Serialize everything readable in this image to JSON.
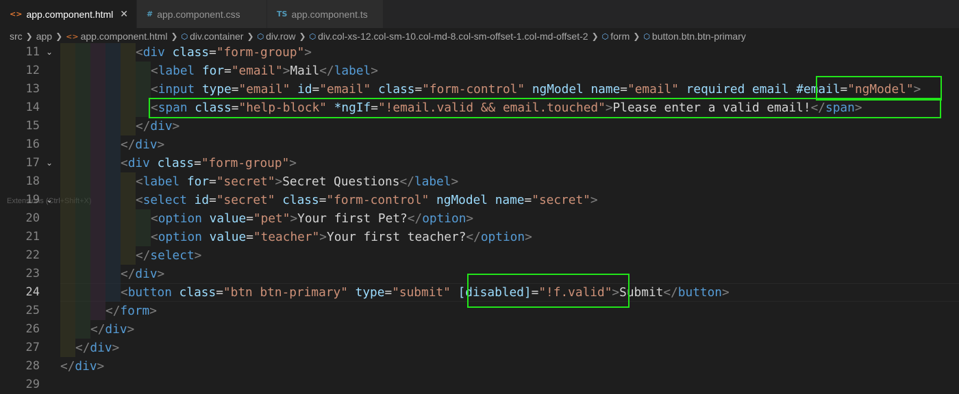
{
  "tabs": [
    {
      "icon": "<>",
      "icon_name": "html-file-icon",
      "label": "app.component.html",
      "active": true,
      "color": "#e37933"
    },
    {
      "icon": "#",
      "icon_name": "css-file-icon",
      "label": "app.component.css",
      "active": false,
      "color": "#519aba"
    },
    {
      "icon": "TS",
      "icon_name": "ts-file-icon",
      "label": "app.component.ts",
      "active": false,
      "color": "#519aba"
    }
  ],
  "breadcrumb": [
    {
      "label": "src",
      "icon": ""
    },
    {
      "label": "app",
      "icon": ""
    },
    {
      "label": "app.component.html",
      "icon": "<>"
    },
    {
      "label": "div.container",
      "icon": "⬡"
    },
    {
      "label": "div.row",
      "icon": "⬡"
    },
    {
      "label": "div.col-xs-12.col-sm-10.col-md-8.col-sm-offset-1.col-md-offset-2",
      "icon": "⬡"
    },
    {
      "label": "form",
      "icon": "⬡"
    },
    {
      "label": "button.btn.btn-primary",
      "icon": "⬡"
    }
  ],
  "ghost_tooltip": "Extensions (Ctrl+Shift+X)",
  "current_line": 24,
  "lines": [
    {
      "n": "11",
      "fold": true,
      "indent": 5,
      "tokens": [
        [
          "br",
          "<"
        ],
        [
          "tag",
          "div"
        ],
        [
          "txt",
          " "
        ],
        [
          "attr",
          "class"
        ],
        [
          "txt",
          "="
        ],
        [
          "str",
          "\"form-group\""
        ],
        [
          "br",
          ">"
        ]
      ]
    },
    {
      "n": "12",
      "fold": false,
      "indent": 6,
      "tokens": [
        [
          "br",
          "<"
        ],
        [
          "tag",
          "label"
        ],
        [
          "txt",
          " "
        ],
        [
          "attr",
          "for"
        ],
        [
          "txt",
          "="
        ],
        [
          "str",
          "\"email\""
        ],
        [
          "br",
          ">"
        ],
        [
          "txt",
          "Mail"
        ],
        [
          "br",
          "</"
        ],
        [
          "tag",
          "label"
        ],
        [
          "br",
          ">"
        ]
      ]
    },
    {
      "n": "13",
      "fold": false,
      "indent": 6,
      "tokens": [
        [
          "br",
          "<"
        ],
        [
          "tag",
          "input"
        ],
        [
          "txt",
          " "
        ],
        [
          "attr",
          "type"
        ],
        [
          "txt",
          "="
        ],
        [
          "str",
          "\"email\""
        ],
        [
          "txt",
          " "
        ],
        [
          "attr",
          "id"
        ],
        [
          "txt",
          "="
        ],
        [
          "str",
          "\"email\""
        ],
        [
          "txt",
          " "
        ],
        [
          "attr",
          "class"
        ],
        [
          "txt",
          "="
        ],
        [
          "str",
          "\"form-control\""
        ],
        [
          "txt",
          " "
        ],
        [
          "attr",
          "ngModel"
        ],
        [
          "txt",
          " "
        ],
        [
          "attr",
          "name"
        ],
        [
          "txt",
          "="
        ],
        [
          "str",
          "\"email\""
        ],
        [
          "txt",
          " "
        ],
        [
          "attr",
          "required"
        ],
        [
          "txt",
          " "
        ],
        [
          "attr",
          "email"
        ],
        [
          "txt",
          " "
        ],
        [
          "attr",
          "#email"
        ],
        [
          "txt",
          "="
        ],
        [
          "str",
          "\"ngModel\""
        ],
        [
          "br",
          ">"
        ]
      ]
    },
    {
      "n": "14",
      "fold": false,
      "indent": 6,
      "tokens": [
        [
          "br",
          "<"
        ],
        [
          "tag",
          "span"
        ],
        [
          "txt",
          " "
        ],
        [
          "attr",
          "class"
        ],
        [
          "txt",
          "="
        ],
        [
          "str",
          "\"help-block\""
        ],
        [
          "txt",
          " "
        ],
        [
          "attr",
          "*ngIf"
        ],
        [
          "txt",
          "="
        ],
        [
          "str",
          "\"!email.valid && email.touched\""
        ],
        [
          "br",
          ">"
        ],
        [
          "txt",
          "Please enter a valid email!"
        ],
        [
          "br",
          "</"
        ],
        [
          "tag",
          "span"
        ],
        [
          "br",
          ">"
        ]
      ]
    },
    {
      "n": "15",
      "fold": false,
      "indent": 5,
      "tokens": [
        [
          "br",
          "</"
        ],
        [
          "tag",
          "div"
        ],
        [
          "br",
          ">"
        ]
      ]
    },
    {
      "n": "16",
      "fold": false,
      "indent": 4,
      "tokens": [
        [
          "br",
          "</"
        ],
        [
          "tag",
          "div"
        ],
        [
          "br",
          ">"
        ]
      ]
    },
    {
      "n": "17",
      "fold": true,
      "indent": 4,
      "tokens": [
        [
          "br",
          "<"
        ],
        [
          "tag",
          "div"
        ],
        [
          "txt",
          " "
        ],
        [
          "attr",
          "class"
        ],
        [
          "txt",
          "="
        ],
        [
          "str",
          "\"form-group\""
        ],
        [
          "br",
          ">"
        ]
      ]
    },
    {
      "n": "18",
      "fold": false,
      "indent": 5,
      "tokens": [
        [
          "br",
          "<"
        ],
        [
          "tag",
          "label"
        ],
        [
          "txt",
          " "
        ],
        [
          "attr",
          "for"
        ],
        [
          "txt",
          "="
        ],
        [
          "str",
          "\"secret\""
        ],
        [
          "br",
          ">"
        ],
        [
          "txt",
          "Secret Questions"
        ],
        [
          "br",
          "</"
        ],
        [
          "tag",
          "label"
        ],
        [
          "br",
          ">"
        ]
      ]
    },
    {
      "n": "19",
      "fold": true,
      "indent": 5,
      "tokens": [
        [
          "br",
          "<"
        ],
        [
          "tag",
          "select"
        ],
        [
          "txt",
          " "
        ],
        [
          "attr",
          "id"
        ],
        [
          "txt",
          "="
        ],
        [
          "str",
          "\"secret\""
        ],
        [
          "txt",
          " "
        ],
        [
          "attr",
          "class"
        ],
        [
          "txt",
          "="
        ],
        [
          "str",
          "\"form-control\""
        ],
        [
          "txt",
          " "
        ],
        [
          "attr",
          "ngModel"
        ],
        [
          "txt",
          " "
        ],
        [
          "attr",
          "name"
        ],
        [
          "txt",
          "="
        ],
        [
          "str",
          "\"secret\""
        ],
        [
          "br",
          ">"
        ]
      ]
    },
    {
      "n": "20",
      "fold": false,
      "indent": 6,
      "tokens": [
        [
          "br",
          "<"
        ],
        [
          "tag",
          "option"
        ],
        [
          "txt",
          " "
        ],
        [
          "attr",
          "value"
        ],
        [
          "txt",
          "="
        ],
        [
          "str",
          "\"pet\""
        ],
        [
          "br",
          ">"
        ],
        [
          "txt",
          "Your first Pet?"
        ],
        [
          "br",
          "</"
        ],
        [
          "tag",
          "option"
        ],
        [
          "br",
          ">"
        ]
      ]
    },
    {
      "n": "21",
      "fold": false,
      "indent": 6,
      "tokens": [
        [
          "br",
          "<"
        ],
        [
          "tag",
          "option"
        ],
        [
          "txt",
          " "
        ],
        [
          "attr",
          "value"
        ],
        [
          "txt",
          "="
        ],
        [
          "str",
          "\"teacher\""
        ],
        [
          "br",
          ">"
        ],
        [
          "txt",
          "Your first teacher?"
        ],
        [
          "br",
          "</"
        ],
        [
          "tag",
          "option"
        ],
        [
          "br",
          ">"
        ]
      ]
    },
    {
      "n": "22",
      "fold": false,
      "indent": 5,
      "tokens": [
        [
          "br",
          "</"
        ],
        [
          "tag",
          "select"
        ],
        [
          "br",
          ">"
        ]
      ]
    },
    {
      "n": "23",
      "fold": false,
      "indent": 4,
      "tokens": [
        [
          "br",
          "</"
        ],
        [
          "tag",
          "div"
        ],
        [
          "br",
          ">"
        ]
      ]
    },
    {
      "n": "24",
      "fold": false,
      "indent": 4,
      "tokens": [
        [
          "br",
          "<"
        ],
        [
          "tag",
          "button"
        ],
        [
          "txt",
          " "
        ],
        [
          "attr",
          "class"
        ],
        [
          "txt",
          "="
        ],
        [
          "str",
          "\"btn btn-primary\""
        ],
        [
          "txt",
          " "
        ],
        [
          "attr",
          "type"
        ],
        [
          "txt",
          "="
        ],
        [
          "str",
          "\"submit\""
        ],
        [
          "txt",
          " "
        ],
        [
          "attr",
          "[disabled]"
        ],
        [
          "txt",
          "="
        ],
        [
          "str",
          "\"!f.valid\""
        ],
        [
          "br",
          ">"
        ],
        [
          "txt",
          "Submit"
        ],
        [
          "br",
          "</"
        ],
        [
          "tag",
          "button"
        ],
        [
          "br",
          ">"
        ]
      ]
    },
    {
      "n": "25",
      "fold": false,
      "indent": 3,
      "tokens": [
        [
          "br",
          "</"
        ],
        [
          "tag",
          "form"
        ],
        [
          "br",
          ">"
        ]
      ]
    },
    {
      "n": "26",
      "fold": false,
      "indent": 2,
      "tokens": [
        [
          "br",
          "</"
        ],
        [
          "tag",
          "div"
        ],
        [
          "br",
          ">"
        ]
      ]
    },
    {
      "n": "27",
      "fold": false,
      "indent": 1,
      "tokens": [
        [
          "br",
          "</"
        ],
        [
          "tag",
          "div"
        ],
        [
          "br",
          ">"
        ]
      ]
    },
    {
      "n": "28",
      "fold": false,
      "indent": 0,
      "tokens": [
        [
          "br",
          "</"
        ],
        [
          "tag",
          "div"
        ],
        [
          "br",
          ">"
        ]
      ]
    },
    {
      "n": "29",
      "fold": false,
      "indent": 0,
      "tokens": []
    }
  ],
  "guide_colors": [
    "#3b3b22",
    "#2a3a2a",
    "#3a2a3a",
    "#22313f",
    "#3b3b22",
    "#2a3a2a",
    "#3a2a3a"
  ],
  "highlight_color": "#22e51a"
}
